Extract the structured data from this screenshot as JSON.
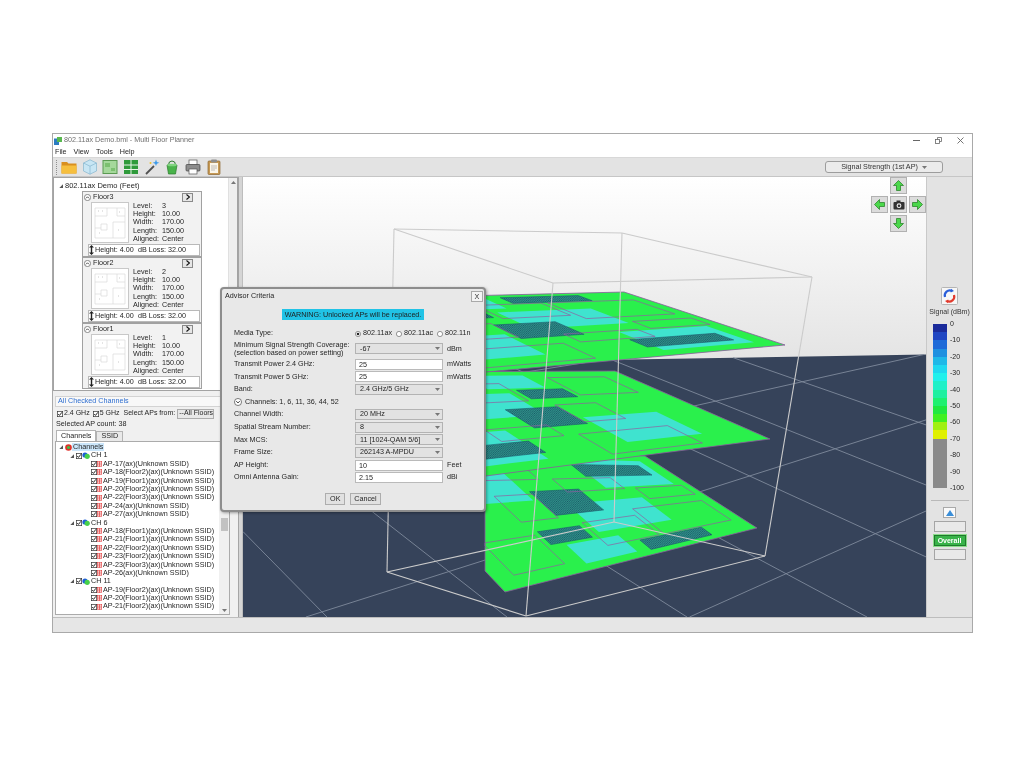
{
  "window": {
    "title": "802.11ax Demo.bml - Multi Floor Planner"
  },
  "menu": [
    {
      "label": "File"
    },
    {
      "label": "View"
    },
    {
      "label": "Tools"
    },
    {
      "label": "Help"
    }
  ],
  "view_selector": {
    "value": "Signal Strength (1st AP)"
  },
  "project": {
    "title": "802.11ax Demo (Feet)",
    "expanded": true,
    "floors": [
      {
        "name": "Floor3",
        "expanded": true,
        "fields": [
          {
            "label": "Level:",
            "value": "3"
          },
          {
            "label": "Height:",
            "value": "10.00"
          },
          {
            "label": "Width:",
            "value": "170.00"
          },
          {
            "label": "Length:",
            "value": "150.00"
          },
          {
            "label": "Aligned:",
            "value": "Center"
          }
        ],
        "spacing": "Height: 4.00",
        "loss": "dB Loss: 32.00"
      },
      {
        "name": "Floor2",
        "expanded": true,
        "fields": [
          {
            "label": "Level:",
            "value": "2"
          },
          {
            "label": "Height:",
            "value": "10.00"
          },
          {
            "label": "Width:",
            "value": "170.00"
          },
          {
            "label": "Length:",
            "value": "150.00"
          },
          {
            "label": "Aligned:",
            "value": "Center"
          }
        ],
        "spacing": "Height: 4.00",
        "loss": "dB Loss: 32.00"
      },
      {
        "name": "Floor1",
        "expanded": true,
        "fields": [
          {
            "label": "Level:",
            "value": "1"
          },
          {
            "label": "Height:",
            "value": "10.00"
          },
          {
            "label": "Width:",
            "value": "170.00"
          },
          {
            "label": "Length:",
            "value": "150.00"
          },
          {
            "label": "Aligned:",
            "value": "Center"
          }
        ],
        "spacing": "Height: 4.00",
        "loss": "dB Loss: 32.00"
      }
    ]
  },
  "channels_panel": {
    "title": "All Checked Channels",
    "bands": [
      {
        "label": "2.4 GHz",
        "checked": true
      },
      {
        "label": "5 GHz",
        "checked": true
      }
    ],
    "source": {
      "label": "Select APs from:",
      "value": "--All Floors"
    },
    "count": "Selected AP count: 38",
    "tabs": [
      {
        "label": "Channels",
        "selected": true
      },
      {
        "label": "SSID",
        "selected": false
      }
    ],
    "tree": {
      "label": "Channels",
      "expanded": true,
      "selected": true,
      "children": [
        {
          "label": "CH 1",
          "checked": true,
          "expanded": true,
          "children": [
            {
              "label": "AP-17(ax)(Unknown SSID)",
              "checked": true
            },
            {
              "label": "AP-18(Floor2)(ax)(Unknown SSID)",
              "checked": true
            },
            {
              "label": "AP-19(Floor1)(ax)(Unknown SSID)",
              "checked": true
            },
            {
              "label": "AP-20(Floor2)(ax)(Unknown SSID)",
              "checked": true
            },
            {
              "label": "AP-22(Floor3)(ax)(Unknown SSID)",
              "checked": true
            },
            {
              "label": "AP-24(ax)(Unknown SSID)",
              "checked": true
            },
            {
              "label": "AP-27(ax)(Unknown SSID)",
              "checked": true
            }
          ]
        },
        {
          "label": "CH 6",
          "checked": true,
          "expanded": true,
          "children": [
            {
              "label": "AP-18(Floor1)(ax)(Unknown SSID)",
              "checked": true
            },
            {
              "label": "AP-21(Floor1)(ax)(Unknown SSID)",
              "checked": true
            },
            {
              "label": "AP-22(Floor2)(ax)(Unknown SSID)",
              "checked": true
            },
            {
              "label": "AP-23(Floor2)(ax)(Unknown SSID)",
              "checked": true
            },
            {
              "label": "AP-23(Floor3)(ax)(Unknown SSID)",
              "checked": true
            },
            {
              "label": "AP-26(ax)(Unknown SSID)",
              "checked": true
            }
          ]
        },
        {
          "label": "CH 11",
          "checked": true,
          "expanded": true,
          "children": [
            {
              "label": "AP-19(Floor2)(ax)(Unknown SSID)",
              "checked": true
            },
            {
              "label": "AP-20(Floor1)(ax)(Unknown SSID)",
              "checked": true
            },
            {
              "label": "AP-21(Floor2)(ax)(Unknown SSID)",
              "checked": true
            }
          ]
        }
      ]
    }
  },
  "legend": {
    "title": "Signal (dBm)",
    "labels": [
      "0",
      "-10",
      "-20",
      "-30",
      "-40",
      "-50",
      "-60",
      "-70",
      "-80",
      "-90",
      "-100"
    ],
    "bands": [
      {
        "color": "#1a2a9a"
      },
      {
        "color": "#1f45c2"
      },
      {
        "color": "#1e6ad8"
      },
      {
        "color": "#1f90e0"
      },
      {
        "color": "#20b8e8"
      },
      {
        "color": "#20d8f0"
      },
      {
        "color": "#22f0ec"
      },
      {
        "color": "#20f0c8"
      },
      {
        "color": "#20f0a0"
      },
      {
        "color": "#20f070"
      },
      {
        "color": "#20e840"
      },
      {
        "color": "#40f020"
      },
      {
        "color": "#a0f010"
      },
      {
        "color": "#e0f000"
      },
      {
        "color": "#8a8a8a"
      },
      {
        "color": "#8a8a8a"
      },
      {
        "color": "#8a8a8a"
      },
      {
        "color": "#8a8a8a"
      },
      {
        "color": "#8a8a8a"
      },
      {
        "color": "#8a8a8a"
      }
    ]
  },
  "view_modes": [
    {
      "selected": false
    },
    {
      "label": "Overall",
      "selected": true
    },
    {
      "selected": false
    }
  ],
  "dialog": {
    "title": "Advisor Criteria",
    "close_label": "X",
    "warning": "WARNING: Unlocked APs will be replaced.",
    "fields": [
      {
        "kind": "radio",
        "label": "Media Type:",
        "options": [
          {
            "label": "802.11ax",
            "selected": true
          },
          {
            "label": "802.11ac",
            "selected": false
          },
          {
            "label": "802.11n",
            "selected": false
          }
        ]
      },
      {
        "kind": "select",
        "label": "Minimum Signal Strength Coverage:",
        "note": "(selection based on power setting)",
        "value": "-67",
        "unit": "dBm"
      },
      {
        "kind": "input",
        "label": "Transmit Power 2.4 GHz:",
        "value": "25",
        "unit": "mWatts"
      },
      {
        "kind": "input",
        "label": "Transmit Power 5 GHz:",
        "value": "25",
        "unit": "mWatts"
      },
      {
        "kind": "select",
        "label": "Band:",
        "value": "2.4 GHz/5 GHz"
      },
      {
        "kind": "expander",
        "label": "Channels: 1, 6, 11, 36, 44, 52",
        "expanded": false
      },
      {
        "kind": "select",
        "label": "Channel Width:",
        "value": "20 MHz"
      },
      {
        "kind": "select",
        "label": "Spatial Stream Number:",
        "value": "8"
      },
      {
        "kind": "select",
        "label": "Max MCS:",
        "value": "11 [1024-QAM 5/6]"
      },
      {
        "kind": "select",
        "label": "Frame Size:",
        "value": "262143 A-MPDU"
      },
      {
        "kind": "input",
        "label": "AP Height:",
        "value": "10",
        "unit": "Feet"
      },
      {
        "kind": "input",
        "label": "Omni Antenna Gain:",
        "value": "2.15",
        "unit": "dBi"
      }
    ],
    "buttons": [
      {
        "label": "OK"
      },
      {
        "label": "Cancel"
      }
    ]
  }
}
